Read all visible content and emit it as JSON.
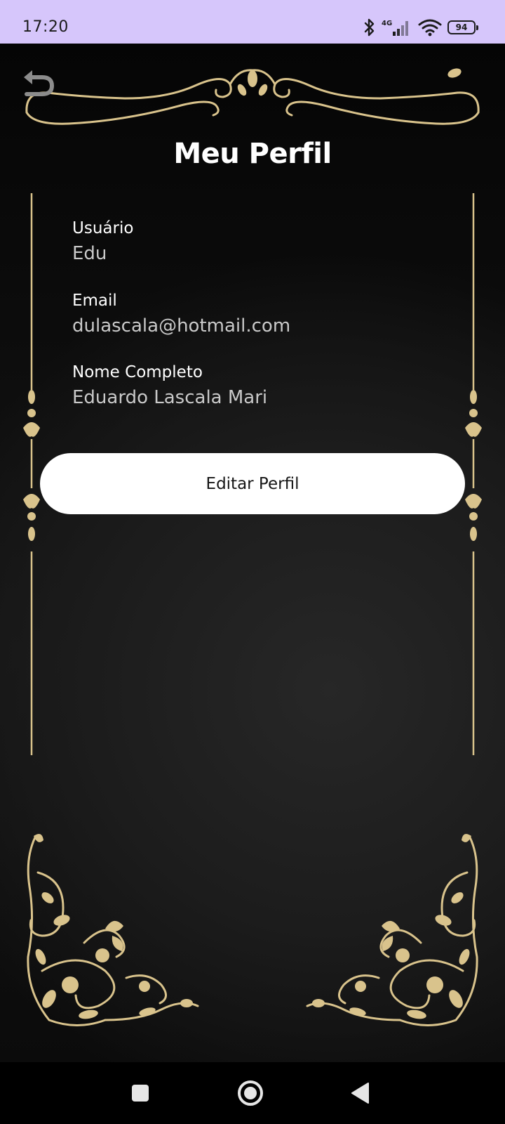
{
  "status_bar": {
    "time": "17:20",
    "network": "4G",
    "battery": "94",
    "icons": [
      "bluetooth-icon",
      "signal-icon",
      "wifi-icon",
      "battery-icon"
    ]
  },
  "header": {
    "title": "Meu Perfil",
    "back_icon": "undo-arrow-icon"
  },
  "profile": {
    "fields": [
      {
        "label": "Usuário",
        "value": "Edu"
      },
      {
        "label": "Email",
        "value": "dulascala@hotmail.com"
      },
      {
        "label": "Nome Completo",
        "value": "Eduardo Lascala Mari"
      }
    ]
  },
  "actions": {
    "edit_label": "Editar Perfil"
  },
  "nav": {
    "icons": [
      "recents-square-icon",
      "home-circle-icon",
      "back-triangle-icon"
    ]
  },
  "theme": {
    "gold": "#d9c38c",
    "background": "#000000",
    "status_bar": "#d6c6fb",
    "button": "#ffffff"
  }
}
